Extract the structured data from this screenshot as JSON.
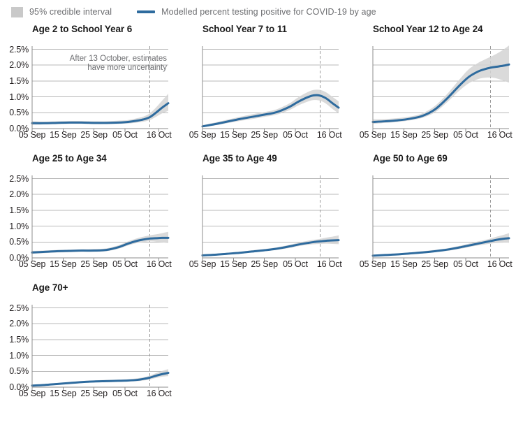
{
  "legend": {
    "items": [
      {
        "icon": "ci-band-swatch",
        "label": "95% credible interval",
        "color": "#c9c9c9",
        "type": "band"
      },
      {
        "icon": "line-swatch",
        "label": "Modelled percent testing positive for COVID-19 by age",
        "color": "#2e6b9e",
        "type": "line"
      }
    ]
  },
  "annotation": {
    "text": "After 13 October, estimates\nhave more uncertainty"
  },
  "colors": {
    "line": "#2e6b9e",
    "band": "#d3d3d3",
    "grid": "#b8b8b8",
    "axis": "#8c8c8c",
    "dashed_marker": "#9a9a9a",
    "title": "#1a1a1a",
    "tick_text": "#231f20",
    "legend_text": "#6d6e71"
  },
  "chart_data": {
    "type": "line",
    "title": "Modelled percent testing positive for COVID-19 by age",
    "xlabel": "",
    "ylabel": "",
    "ylim": [
      0,
      2.6
    ],
    "yticks": [
      "0.0%",
      "0.5%",
      "1.0%",
      "1.5%",
      "2.0%",
      "2.5%"
    ],
    "ytick_values": [
      0.0,
      0.5,
      1.0,
      1.5,
      2.0,
      2.5
    ],
    "xticks": [
      "05 Sep",
      "15 Sep",
      "25 Sep",
      "05 Oct",
      "16 Oct"
    ],
    "xtick_values": [
      0,
      10,
      20,
      30,
      41
    ],
    "xlim": [
      0,
      44
    ],
    "grid": "horizontal",
    "legend_position": "top-left",
    "annotation_marker": {
      "label": "13 October",
      "x_value": 38,
      "style": "dashed-vertical"
    },
    "panels": [
      {
        "title": "Age 2 to School Year 6",
        "show_y_labels": true,
        "show_annotation": true,
        "x": [
          0,
          4,
          8,
          12,
          16,
          20,
          24,
          28,
          31,
          34,
          36,
          38,
          40,
          42,
          44
        ],
        "mean": [
          0.17,
          0.17,
          0.18,
          0.19,
          0.19,
          0.18,
          0.18,
          0.19,
          0.21,
          0.25,
          0.29,
          0.36,
          0.5,
          0.66,
          0.8
        ],
        "lower": [
          0.12,
          0.13,
          0.14,
          0.15,
          0.15,
          0.14,
          0.14,
          0.15,
          0.16,
          0.19,
          0.22,
          0.27,
          0.37,
          0.48,
          0.56
        ],
        "upper": [
          0.23,
          0.22,
          0.23,
          0.24,
          0.24,
          0.23,
          0.23,
          0.25,
          0.27,
          0.33,
          0.38,
          0.48,
          0.66,
          0.88,
          1.1
        ]
      },
      {
        "title": "School Year 7 to 11",
        "show_y_labels": false,
        "show_annotation": false,
        "x": [
          0,
          4,
          8,
          12,
          16,
          20,
          24,
          28,
          31,
          34,
          36,
          38,
          40,
          42,
          44
        ],
        "mean": [
          0.07,
          0.14,
          0.22,
          0.3,
          0.37,
          0.44,
          0.52,
          0.68,
          0.85,
          0.99,
          1.05,
          1.04,
          0.95,
          0.8,
          0.66
        ],
        "lower": [
          0.04,
          0.1,
          0.17,
          0.24,
          0.3,
          0.37,
          0.44,
          0.58,
          0.73,
          0.85,
          0.9,
          0.88,
          0.78,
          0.62,
          0.48
        ],
        "upper": [
          0.11,
          0.19,
          0.28,
          0.37,
          0.45,
          0.52,
          0.61,
          0.79,
          0.99,
          1.15,
          1.22,
          1.22,
          1.14,
          1.0,
          0.86
        ]
      },
      {
        "title": "School Year 12 to Age 24",
        "show_y_labels": false,
        "show_annotation": false,
        "x": [
          0,
          4,
          8,
          12,
          16,
          20,
          24,
          28,
          31,
          34,
          36,
          38,
          40,
          42,
          44
        ],
        "mean": [
          0.21,
          0.23,
          0.26,
          0.31,
          0.4,
          0.6,
          0.95,
          1.36,
          1.63,
          1.8,
          1.87,
          1.92,
          1.95,
          1.98,
          2.02
        ],
        "lower": [
          0.15,
          0.18,
          0.21,
          0.26,
          0.34,
          0.51,
          0.83,
          1.2,
          1.43,
          1.56,
          1.6,
          1.61,
          1.58,
          1.52,
          1.45
        ],
        "upper": [
          0.29,
          0.3,
          0.33,
          0.38,
          0.48,
          0.71,
          1.09,
          1.55,
          1.87,
          2.07,
          2.17,
          2.26,
          2.36,
          2.48,
          2.62
        ]
      },
      {
        "title": "Age 25 to Age 34",
        "show_y_labels": true,
        "show_annotation": false,
        "x": [
          0,
          4,
          8,
          12,
          16,
          20,
          24,
          28,
          31,
          34,
          36,
          38,
          40,
          42,
          44
        ],
        "mean": [
          0.17,
          0.19,
          0.21,
          0.22,
          0.23,
          0.23,
          0.25,
          0.34,
          0.45,
          0.54,
          0.58,
          0.61,
          0.62,
          0.63,
          0.63
        ],
        "lower": [
          0.13,
          0.15,
          0.17,
          0.18,
          0.19,
          0.19,
          0.21,
          0.29,
          0.39,
          0.47,
          0.5,
          0.52,
          0.51,
          0.49,
          0.47
        ],
        "upper": [
          0.22,
          0.23,
          0.25,
          0.26,
          0.27,
          0.28,
          0.3,
          0.4,
          0.52,
          0.62,
          0.67,
          0.71,
          0.74,
          0.78,
          0.82
        ]
      },
      {
        "title": "Age 35 to Age 49",
        "show_y_labels": false,
        "show_annotation": false,
        "x": [
          0,
          4,
          8,
          12,
          16,
          20,
          24,
          28,
          31,
          34,
          36,
          38,
          40,
          42,
          44
        ],
        "mean": [
          0.08,
          0.1,
          0.13,
          0.16,
          0.2,
          0.24,
          0.29,
          0.36,
          0.42,
          0.47,
          0.5,
          0.52,
          0.54,
          0.55,
          0.56
        ],
        "lower": [
          0.06,
          0.08,
          0.1,
          0.13,
          0.17,
          0.21,
          0.25,
          0.31,
          0.37,
          0.41,
          0.43,
          0.44,
          0.45,
          0.44,
          0.43
        ],
        "upper": [
          0.11,
          0.13,
          0.16,
          0.19,
          0.24,
          0.28,
          0.33,
          0.41,
          0.48,
          0.54,
          0.57,
          0.6,
          0.64,
          0.67,
          0.71
        ]
      },
      {
        "title": "Age 50 to Age 69",
        "show_y_labels": false,
        "show_annotation": false,
        "x": [
          0,
          4,
          8,
          12,
          16,
          20,
          24,
          28,
          31,
          34,
          36,
          38,
          40,
          42,
          44
        ],
        "mean": [
          0.07,
          0.09,
          0.11,
          0.14,
          0.17,
          0.21,
          0.26,
          0.33,
          0.39,
          0.45,
          0.49,
          0.53,
          0.57,
          0.6,
          0.62
        ],
        "lower": [
          0.05,
          0.07,
          0.09,
          0.11,
          0.14,
          0.18,
          0.22,
          0.28,
          0.34,
          0.39,
          0.42,
          0.45,
          0.47,
          0.48,
          0.48
        ],
        "upper": [
          0.09,
          0.11,
          0.14,
          0.17,
          0.21,
          0.25,
          0.3,
          0.38,
          0.45,
          0.52,
          0.56,
          0.61,
          0.67,
          0.72,
          0.78
        ]
      },
      {
        "title": "Age 70+",
        "show_y_labels": true,
        "show_annotation": false,
        "x": [
          0,
          4,
          8,
          12,
          16,
          20,
          24,
          28,
          31,
          34,
          36,
          38,
          40,
          42,
          44
        ],
        "mean": [
          0.05,
          0.07,
          0.1,
          0.13,
          0.16,
          0.18,
          0.19,
          0.2,
          0.21,
          0.23,
          0.26,
          0.3,
          0.36,
          0.41,
          0.45
        ],
        "lower": [
          0.03,
          0.05,
          0.08,
          0.1,
          0.13,
          0.15,
          0.16,
          0.17,
          0.18,
          0.19,
          0.21,
          0.24,
          0.29,
          0.33,
          0.35
        ],
        "upper": [
          0.07,
          0.09,
          0.12,
          0.16,
          0.19,
          0.21,
          0.23,
          0.24,
          0.25,
          0.28,
          0.31,
          0.36,
          0.44,
          0.51,
          0.57
        ]
      }
    ]
  }
}
